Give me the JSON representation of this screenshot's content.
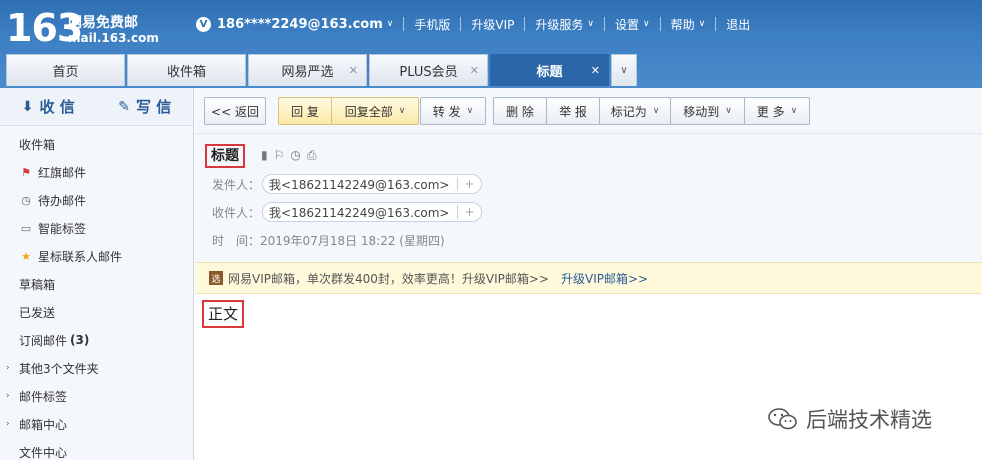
{
  "header": {
    "logo_num": "163",
    "logo_cn": "网易免费邮",
    "logo_domain": "mail.163.com",
    "vip_badge": "V",
    "account": "186****2249@163.com",
    "nav": [
      "手机版",
      "升级VIP",
      "升级服务",
      "设置",
      "帮助",
      "退出"
    ]
  },
  "tabs": [
    {
      "label": "首页"
    },
    {
      "label": "收件箱"
    },
    {
      "label": "网易严选"
    },
    {
      "label": "PLUS会员"
    },
    {
      "label": "标题"
    }
  ],
  "sidebar": {
    "receive": "收 信",
    "write": "写 信",
    "folders": [
      {
        "label": "收件箱"
      },
      {
        "label": "红旗邮件"
      },
      {
        "label": "待办邮件"
      },
      {
        "label": "智能标签"
      },
      {
        "label": "星标联系人邮件"
      },
      {
        "label": "草稿箱"
      },
      {
        "label": "已发送"
      },
      {
        "label": "订阅邮件",
        "count": "(3)"
      },
      {
        "label": "其他3个文件夹"
      },
      {
        "label": "邮件标签"
      },
      {
        "label": "邮箱中心"
      },
      {
        "label": "文件中心"
      }
    ]
  },
  "toolbar": {
    "back": "<< 返回",
    "reply": "回 复",
    "reply_all": "回复全部",
    "forward": "转 发",
    "delete": "删 除",
    "report": "举 报",
    "mark_as": "标记为",
    "move_to": "移动到",
    "more": "更 多"
  },
  "mail": {
    "subject": "标题",
    "from_label": "发件人：",
    "from_value": "我<18621142249@163.com>",
    "to_label": "收件人：",
    "to_value": "我<18621142249@163.com>",
    "time_label": "时　间：",
    "time_value": "2019年07月18日 18:22 (星期四)",
    "body": "正文"
  },
  "vip_bar": {
    "icon": "选",
    "text": "网易VIP邮箱，单次群发400封，效率更高！升级VIP邮箱>>",
    "link": "升级VIP邮箱>>"
  },
  "watermark": "后端技术精选",
  "colors": {
    "header_blue": "#3d7fc3",
    "active_tab": "#2b67a8",
    "highlight_box": "#d8373b",
    "vip_bg": "#fff9dc"
  }
}
